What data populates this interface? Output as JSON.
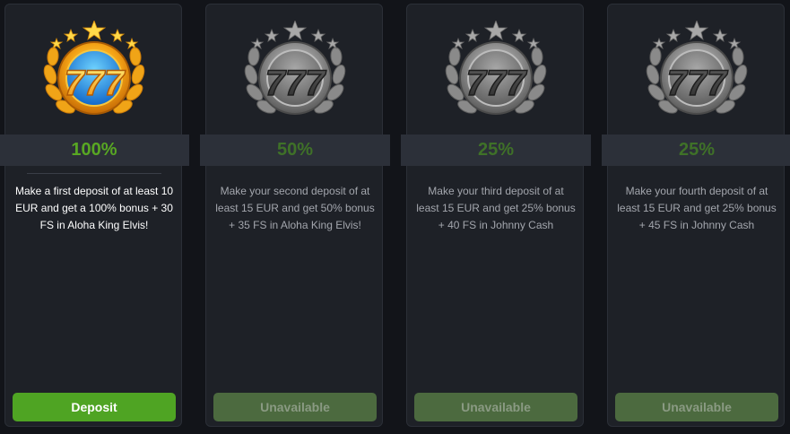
{
  "colors": {
    "page_bg": "#121419",
    "card_bg": "#1e2127",
    "band_bg": "#2c3039",
    "accent_green": "#58a723",
    "button_active": "#4fa423",
    "button_disabled": "#4c6a3f"
  },
  "bonuses": [
    {
      "percent": "100%",
      "description": "Make a first deposit of at least 10 EUR and get a 100% bonus + 30 FS in Aloha King Elvis!",
      "button_label": "Deposit",
      "icon": "gold-777-laurel-badge-icon",
      "state": "active"
    },
    {
      "percent": "50%",
      "description": "Make your second deposit of at least 15 EUR and get 50% bonus + 35 FS in Aloha King Elvis!",
      "button_label": "Unavailable",
      "icon": "silver-777-laurel-badge-icon",
      "state": "locked"
    },
    {
      "percent": "25%",
      "description": "Make your third deposit of at least 15 EUR and get 25% bonus + 40 FS in Johnny Cash",
      "button_label": "Unavailable",
      "icon": "silver-777-laurel-badge-icon",
      "state": "locked"
    },
    {
      "percent": "25%",
      "description": "Make your fourth deposit of at least 15 EUR and get 25% bonus + 45 FS in Johnny Cash",
      "button_label": "Unavailable",
      "icon": "silver-777-laurel-badge-icon",
      "state": "locked"
    }
  ]
}
